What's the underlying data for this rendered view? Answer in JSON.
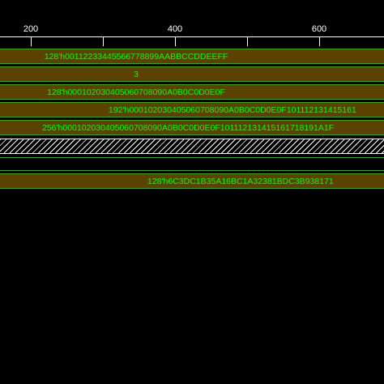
{
  "ruler": {
    "tick_labels": [
      "200",
      "400",
      "600"
    ]
  },
  "signals": [
    {
      "value": "128'h00112233445566778899AABBCCDDEEFF"
    },
    {
      "value": "3"
    },
    {
      "value": "128'h000102030405060708090A0B0C0D0E0F"
    },
    {
      "value": "192'h000102030405060708090A0B0C0D0E0F101112131415161"
    },
    {
      "value": "256'h000102030405060708090A0B0C0D0E0F101112131415161718191A1F"
    },
    {
      "value": "128'h6C3DC1B35A16BC1A32381BDC3B938171"
    }
  ],
  "colors": {
    "background": "#000000",
    "bus_fill": "#5c4200",
    "bus_edge": "#00c800",
    "value_text": "#00ff00",
    "ruler": "#ffffff"
  }
}
